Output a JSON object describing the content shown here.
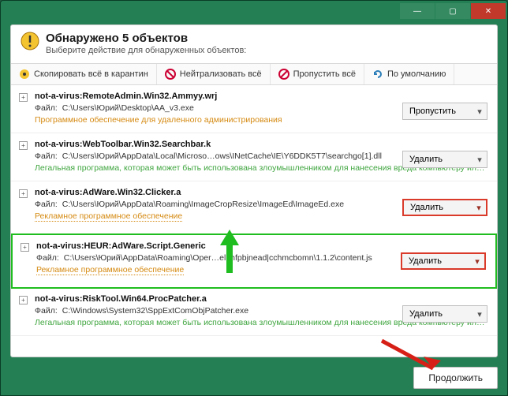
{
  "titlebar": {
    "min": "—",
    "max": "▢",
    "close": "✕"
  },
  "header": {
    "title": "Обнаружено 5 объектов",
    "subtitle": "Выберите действие для обнаруженных объектов:"
  },
  "toolbar": {
    "quarantine": "Скопировать всё в карантин",
    "neutralize": "Нейтрализовать всё",
    "skip": "Пропустить всё",
    "default": "По умолчанию"
  },
  "path_label": "Файл:",
  "items": [
    {
      "threat": "not-a-virus:RemoteAdmin.Win32.Ammyy.wrj",
      "path": "C:\\Users\\Юрий\\Desktop\\AA_v3.exe",
      "info": "Программное обеспечение для удаленного администрирования",
      "info_class": "warn",
      "action": "Пропустить",
      "action_style": "plain"
    },
    {
      "threat": "not-a-virus:WebToolbar.Win32.Searchbar.k",
      "path": "C:\\Users\\Юрий\\AppData\\Local\\Microso…ows\\INetCache\\IE\\Y6DDK5T7\\searchgo[1].dll",
      "info": "Легальная программа, которая может быть использована злоумышленником для нанесения вреда компьютеру ил…",
      "info_class": "legal",
      "action": "Удалить",
      "action_style": "plain"
    },
    {
      "threat": "not-a-virus:AdWare.Win32.Clicker.a",
      "path": "C:\\Users\\Юрий\\AppData\\Roaming\\ImageCropResize\\ImageEd\\ImageEd.exe",
      "info": "Рекламное программное обеспечение",
      "info_class": "link",
      "action": "Удалить",
      "action_style": "red"
    },
    {
      "threat": "not-a-virus:HEUR:AdWare.Script.Generic",
      "path": "C:\\Users\\Юрий\\AppData\\Roaming\\Oper…elphfpbjnead|cchmcbomn\\1.1.2\\content.js",
      "info": "Рекламное программное обеспечение",
      "info_class": "link",
      "action": "Удалить",
      "action_style": "red",
      "highlight": true
    },
    {
      "threat": "not-a-virus:RiskTool.Win64.ProcPatcher.a",
      "path": "C:\\Windows\\System32\\SppExtComObjPatcher.exe",
      "info": "Легальная программа, которая может быть использована злоумышленником для нанесения вреда компьютеру ил…",
      "info_class": "legal",
      "action": "Удалить",
      "action_style": "plain"
    }
  ],
  "footer": {
    "continue": "Продолжить"
  }
}
